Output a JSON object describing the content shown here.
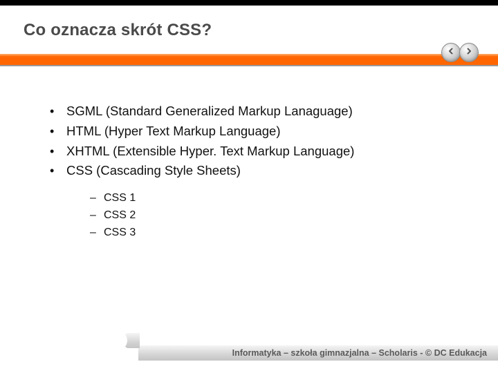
{
  "title": "Co oznacza skrót CSS?",
  "bullets": [
    "SGML (Standard Generalized Markup Lanaguage)",
    "HTML (Hyper Text Markup Language)",
    "XHTML (Extensible Hyper. Text Markup Language)",
    "CSS (Cascading Style Sheets)"
  ],
  "sub_bullets": [
    "CSS 1",
    "CSS 2",
    "CSS 3"
  ],
  "footer": "Informatyka – szkoła gimnazjalna – Scholaris - © DC Edukacja",
  "nav": {
    "prev": "Previous slide",
    "next": "Next slide"
  }
}
